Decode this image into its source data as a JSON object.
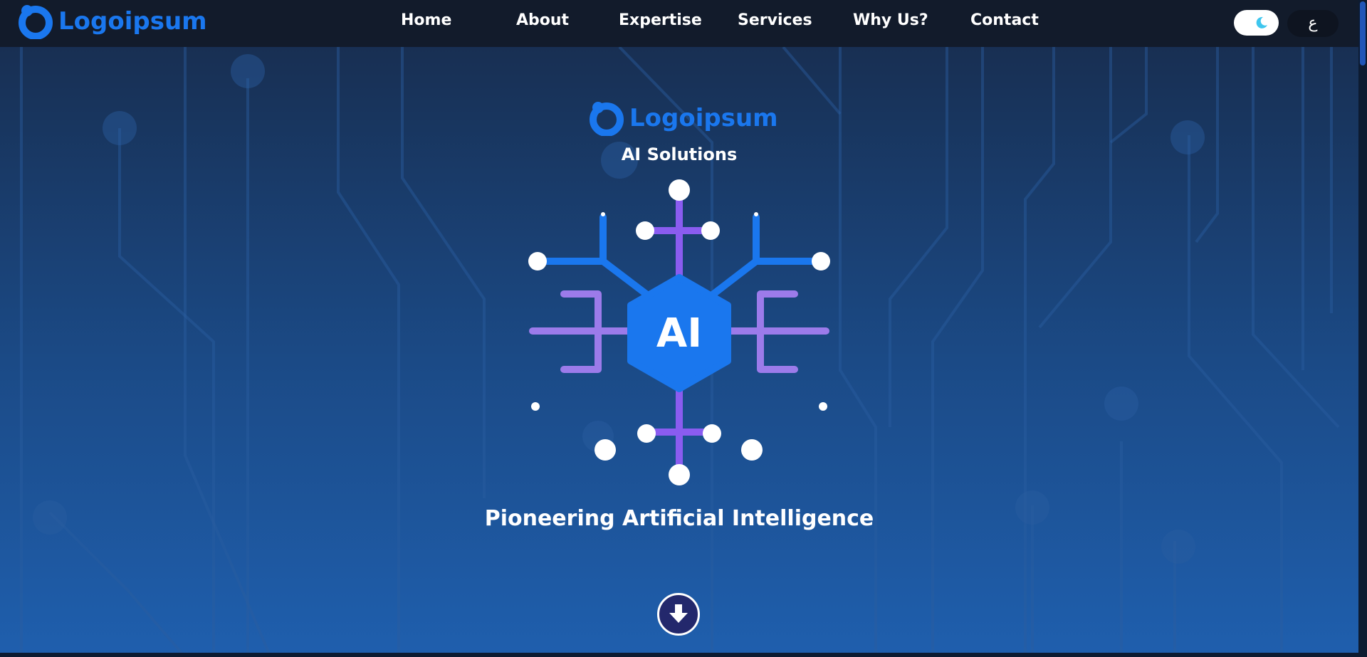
{
  "brand": {
    "name": "Logoipsum",
    "color": "#1a77ee"
  },
  "nav": {
    "links": [
      "Home",
      "About",
      "Expertise",
      "Services",
      "Why Us?",
      "Contact"
    ],
    "theme_toggle_icon": "moon-icon",
    "language_label": "ع"
  },
  "hero": {
    "brand_name": "Logoipsum",
    "subtitle": "AI Solutions",
    "chip_label": "AI",
    "title": "Pioneering Artificial Intelligence",
    "scroll_icon": "arrow-down-icon"
  },
  "colors": {
    "nav_bg": "#121b2b",
    "bg_top": "#172b4b",
    "bg_bottom": "#1f5fae",
    "accent_blue": "#1a77ee",
    "accent_purple": "#8a5cf0",
    "accent_lilac": "#9c7bea",
    "scroll_button": "#23286c"
  }
}
